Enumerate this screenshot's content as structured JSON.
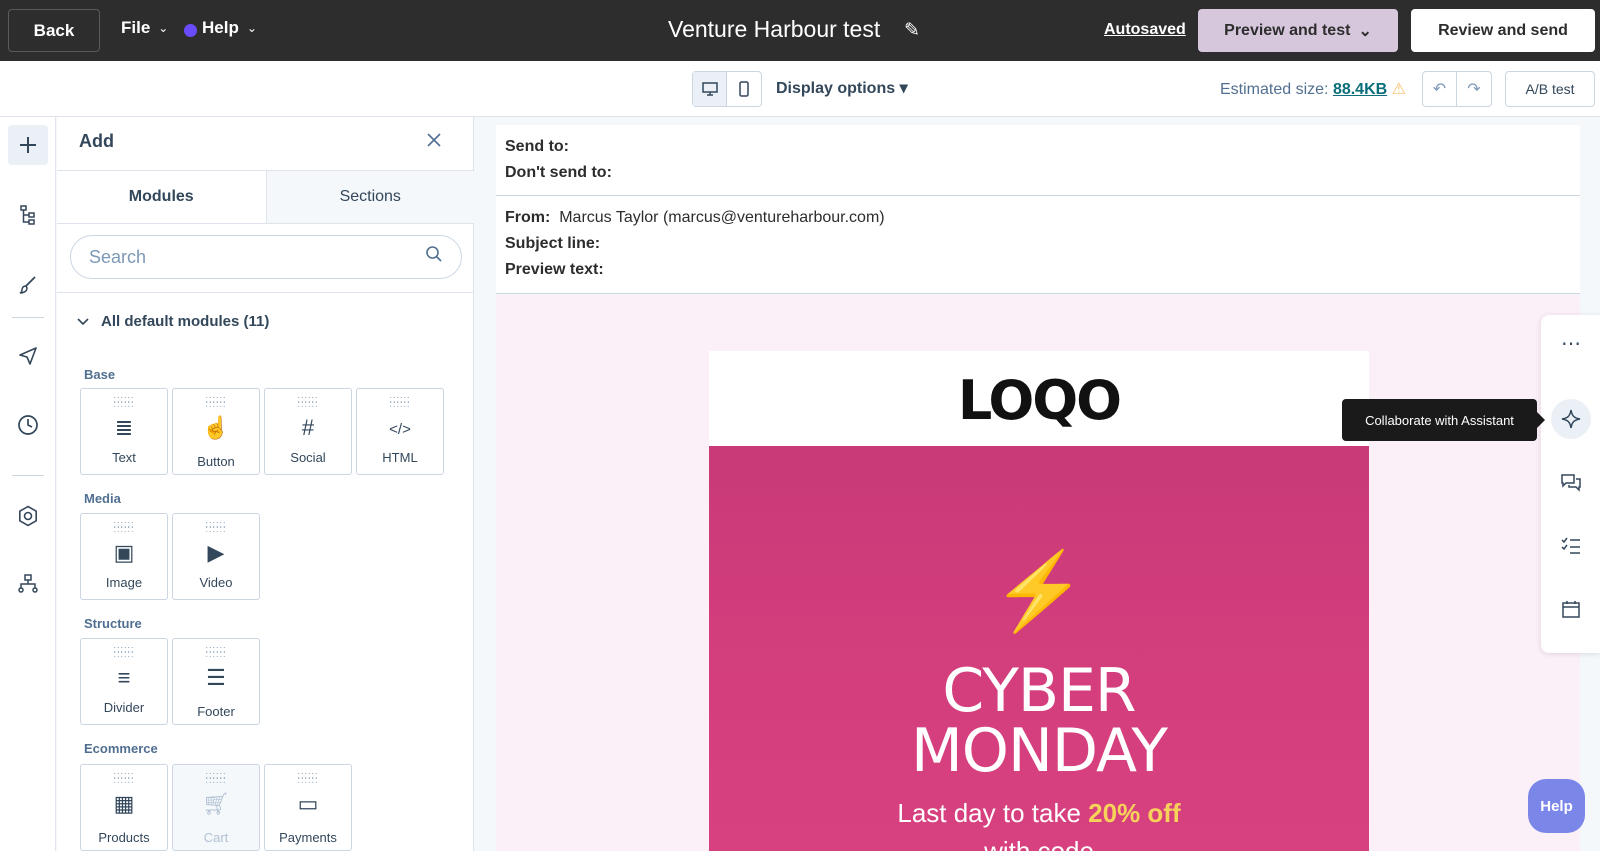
{
  "topbar": {
    "back_label": "Back",
    "file_label": "File",
    "help_label": "Help",
    "title": "Venture Harbour test",
    "autosaved_label": "Autosaved",
    "preview_label": "Preview and test",
    "review_label": "Review and send"
  },
  "subbar": {
    "display_options_label": "Display options ▾",
    "estimated_size_label": "Estimated size:",
    "estimated_size_value": "88.4KB",
    "ab_test_label": "A/B test"
  },
  "panel": {
    "title": "Add",
    "tabs": [
      "Modules",
      "Sections"
    ],
    "search_placeholder": "Search",
    "group_label": "All default modules (11)",
    "categories": [
      "Base",
      "Media",
      "Structure",
      "Ecommerce"
    ],
    "modules": {
      "text": "Text",
      "button": "Button",
      "social": "Social",
      "html": "HTML",
      "image": "Image",
      "video": "Video",
      "divider": "Divider",
      "footer": "Footer",
      "products": "Products",
      "cart": "Cart",
      "payments": "Payments"
    }
  },
  "email": {
    "send_to_label": "Send to:",
    "dont_send_to_label": "Don't send to:",
    "from_label": "From:",
    "from_value": "Marcus Taylor (marcus@ventureharbour.com)",
    "subject_label": "Subject line:",
    "preview_text_label": "Preview text:",
    "logo_text": "LOQO",
    "hero_line1": "CYBER",
    "hero_line2": "MONDAY",
    "hero_sub_pre": "Last day to take ",
    "hero_sub_highlight": "20% off",
    "hero_sub2": "with code"
  },
  "assistant": {
    "tooltip": "Collaborate with Assistant"
  },
  "help_fab_label": "Help",
  "colors": {
    "topbar": "#2d2d2d",
    "preview_button": "#d6c7dd",
    "hero": "#d23d7c",
    "hero_highlight": "#f7d25b",
    "email_background": "#fbeff8",
    "help_fab": "#7a86e8"
  }
}
